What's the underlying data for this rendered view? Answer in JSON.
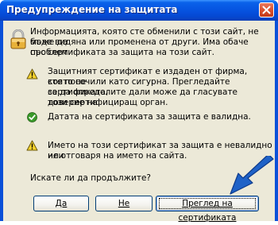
{
  "window": {
    "title": "Предупреждение на защитата"
  },
  "main": {
    "intro_line1": "Информацията, която сте обменили с този сайт, не може да",
    "intro_line2": "бъде видяна или променена от други. Има обаче проблем",
    "intro_line3": "със сертификата за защита на този сайт."
  },
  "items": [
    {
      "icon": "warning-icon",
      "lines": [
        "Защитният сертификат е издаден от фирма, която не",
        "сте посочили като сигурна. Прегледайте сертификата,",
        "за да определите дали може да гласувате доверие на",
        "този сертифициращ орган."
      ]
    },
    {
      "icon": "checkmark-icon",
      "lines": [
        "Датата на сертификата за защита е валидна."
      ]
    },
    {
      "icon": "warning-icon",
      "lines": [
        "Името на този сертификат за защита е невалидно или",
        "не отговаря на името на сайта."
      ]
    }
  ],
  "question": "Искате ли да продължите?",
  "buttons": {
    "yes": "Да",
    "no": "Не",
    "view": "Преглед на сертификата"
  },
  "colors": {
    "titlebar": "#0a50d8",
    "dialog_bg": "#ece9d8",
    "warning_yellow": "#f6d32c",
    "ok_green": "#3a9a2a",
    "arrow_blue": "#1f62c7"
  }
}
